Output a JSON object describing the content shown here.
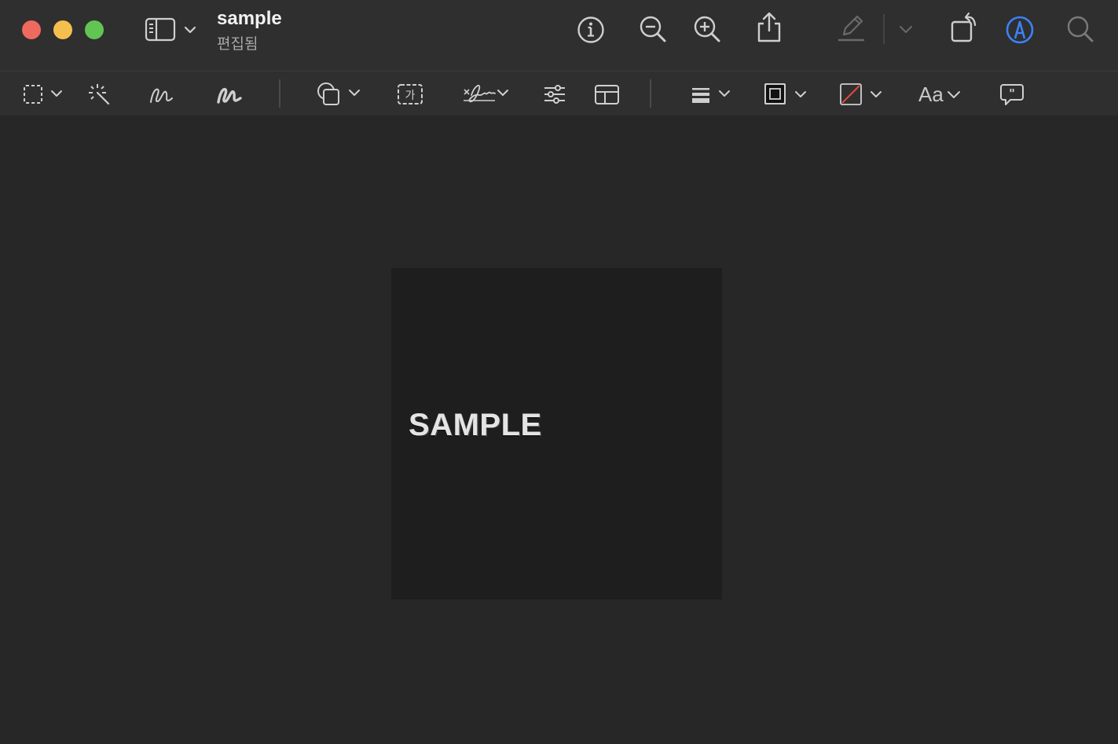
{
  "window": {
    "title": "sample",
    "subtitle": "편집됨"
  },
  "toolbar": {
    "items": [
      "sidebar-toggle",
      "info",
      "zoom-out",
      "zoom-in",
      "share",
      "highlight",
      "highlight-options",
      "rotate",
      "markup",
      "search"
    ]
  },
  "markup_toolbar": {
    "text_style_label": "Aa",
    "text_box_glyph": "가"
  },
  "document": {
    "page_text": "SAMPLE"
  },
  "colors": {
    "background": "#272727",
    "toolbar": "#2f2f2f",
    "page": "#1e1e1e",
    "accent": "#3b82f6",
    "close": "#ee6a5f",
    "minimize": "#f5bf4f",
    "maximize": "#61c554"
  }
}
